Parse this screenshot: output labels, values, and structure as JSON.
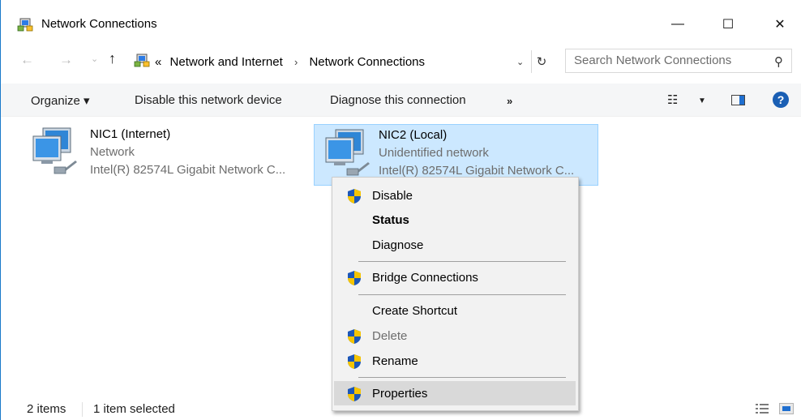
{
  "window": {
    "title": "Network Connections",
    "controls": {
      "minimize": "—",
      "maximize": "☐",
      "close": "✕"
    }
  },
  "nav": {
    "back": "←",
    "forward": "→",
    "recent": "⌄",
    "up": "↑",
    "breadcrumb_prefix": "«",
    "breadcrumbs": [
      "Network and Internet",
      "Network Connections"
    ],
    "breadcrumb_separator": "›",
    "dropdown": "⌄",
    "refresh": "↻",
    "search_placeholder": "Search Network Connections",
    "search_icon": "⚲"
  },
  "commands": {
    "organize": "Organize ▾",
    "disable": "Disable this network device",
    "diagnose": "Diagnose this connection",
    "more": "»",
    "view": "☷",
    "view_dropdown": "▼",
    "help": "?"
  },
  "items": [
    {
      "name": "NIC1 (Internet)",
      "status": "Network",
      "device": "Intel(R) 82574L Gigabit Network C..."
    },
    {
      "name": "NIC2 (Local)",
      "status": "Unidentified network",
      "device": "Intel(R) 82574L Gigabit Network C..."
    }
  ],
  "context_menu": {
    "disable": "Disable",
    "status": "Status",
    "diagnose": "Diagnose",
    "bridge": "Bridge Connections",
    "shortcut": "Create Shortcut",
    "delete": "Delete",
    "rename": "Rename",
    "properties": "Properties"
  },
  "statusbar": {
    "items_count": "2 items",
    "selected": "1 item selected"
  },
  "colors": {
    "selection_bg": "#cce8ff",
    "selection_border": "#99d1ff",
    "menu_bg": "#f2f2f2",
    "menu_hover": "#d9d9d9",
    "shield_blue": "#1c57b8",
    "shield_yellow": "#f5c400"
  }
}
